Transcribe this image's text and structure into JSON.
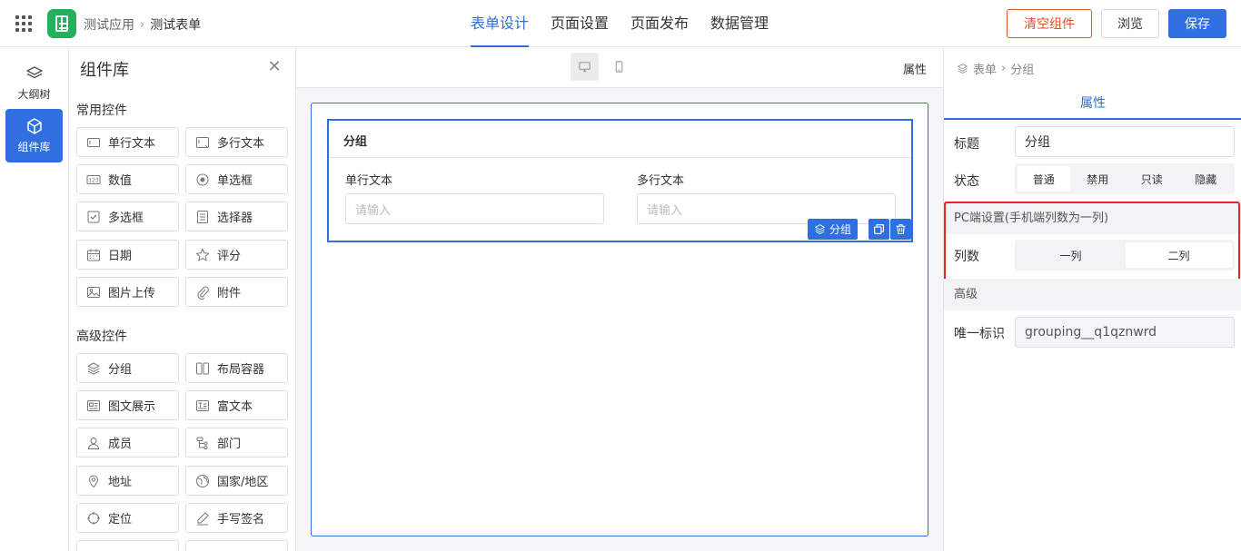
{
  "topbar": {
    "breadcrumb": [
      "测试应用",
      "测试表单"
    ],
    "tabs": [
      {
        "label": "表单设计",
        "active": true
      },
      {
        "label": "页面设置",
        "active": false
      },
      {
        "label": "页面发布",
        "active": false
      },
      {
        "label": "数据管理",
        "active": false
      }
    ],
    "buttons": {
      "clear": "清空组件",
      "preview": "浏览",
      "save": "保存"
    },
    "accent_color": "#2f6fe0",
    "danger_color": "#e0532f",
    "logo_color": "#23b05b"
  },
  "rail": {
    "items": [
      {
        "label": "大纲树",
        "icon": "layers-icon",
        "active": false
      },
      {
        "label": "组件库",
        "icon": "cube-icon",
        "active": true
      }
    ]
  },
  "library": {
    "title": "组件库",
    "sections": [
      {
        "title": "常用控件",
        "items": [
          {
            "label": "单行文本",
            "icon": "single-line-text-icon"
          },
          {
            "label": "多行文本",
            "icon": "multi-line-text-icon"
          },
          {
            "label": "数值",
            "icon": "number-icon"
          },
          {
            "label": "单选框",
            "icon": "radio-icon"
          },
          {
            "label": "多选框",
            "icon": "checkbox-icon"
          },
          {
            "label": "选择器",
            "icon": "select-icon"
          },
          {
            "label": "日期",
            "icon": "calendar-icon"
          },
          {
            "label": "评分",
            "icon": "star-icon"
          },
          {
            "label": "图片上传",
            "icon": "image-icon"
          },
          {
            "label": "附件",
            "icon": "paperclip-icon"
          }
        ]
      },
      {
        "title": "高级控件",
        "items": [
          {
            "label": "分组",
            "icon": "layers-icon"
          },
          {
            "label": "布局容器",
            "icon": "columns-icon"
          },
          {
            "label": "图文展示",
            "icon": "media-card-icon"
          },
          {
            "label": "富文本",
            "icon": "rich-text-icon"
          },
          {
            "label": "成员",
            "icon": "user-icon"
          },
          {
            "label": "部门",
            "icon": "org-tree-icon"
          },
          {
            "label": "地址",
            "icon": "map-pin-icon"
          },
          {
            "label": "国家/地区",
            "icon": "globe-icon"
          },
          {
            "label": "定位",
            "icon": "crosshair-icon"
          },
          {
            "label": "手写签名",
            "icon": "pen-icon"
          }
        ]
      }
    ]
  },
  "canvas": {
    "toolbar_attr": "属性",
    "devices": [
      {
        "icon": "desktop-icon",
        "active": true
      },
      {
        "icon": "mobile-icon",
        "active": false
      }
    ],
    "group": {
      "title": "分组",
      "fields": [
        {
          "label": "单行文本",
          "placeholder": "请输入"
        },
        {
          "label": "多行文本",
          "placeholder": "请输入"
        }
      ],
      "selected_tag": "分组"
    }
  },
  "props": {
    "breadcrumb": [
      "表单",
      "分组"
    ],
    "tab": "属性",
    "title_label": "标题",
    "title_value": "分组",
    "status_label": "状态",
    "status_options": [
      {
        "label": "普通",
        "active": true
      },
      {
        "label": "禁用",
        "active": false
      },
      {
        "label": "只读",
        "active": false
      },
      {
        "label": "隐藏",
        "active": false
      }
    ],
    "pc_section": "PC端设置(手机端列数为一列)",
    "columns_label": "列数",
    "columns_options": [
      {
        "label": "一列",
        "active": false
      },
      {
        "label": "二列",
        "active": true
      }
    ],
    "advanced_section": "高级",
    "unique_id_label": "唯一标识",
    "unique_id_value": "grouping__q1qznwrd",
    "highlight_color": "#e8251f"
  }
}
